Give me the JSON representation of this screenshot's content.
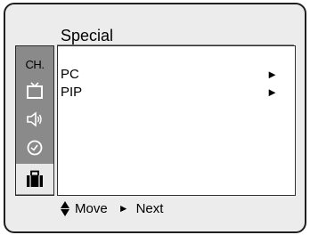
{
  "menu": {
    "title": "Special",
    "items": [
      {
        "label": "PC",
        "arrow": "►"
      },
      {
        "label": "PIP",
        "arrow": "►"
      }
    ]
  },
  "sidebar": {
    "items": [
      {
        "label": "CH.",
        "icon": "channel-icon",
        "active": false
      },
      {
        "icon": "tv-icon",
        "active": false
      },
      {
        "icon": "speaker-icon",
        "active": false
      },
      {
        "icon": "clock-icon",
        "active": false
      },
      {
        "icon": "briefcase-icon",
        "active": true
      }
    ]
  },
  "footer": {
    "move_label": "Move",
    "next_arrow": "►",
    "next_label": "Next"
  },
  "colors": {
    "frame": "#ececec",
    "sidebar": "#8a8a8a",
    "active_item": "#e8e8e8",
    "panel": "#ffffff"
  }
}
